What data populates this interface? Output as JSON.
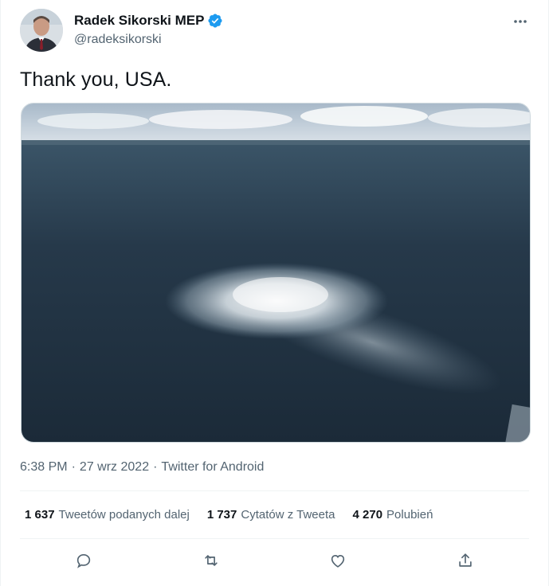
{
  "author": {
    "display_name": "Radek Sikorski MEP",
    "handle": "@radeksikorski",
    "verified_icon": "verified-badge-icon"
  },
  "tweet": {
    "text": "Thank you, USA.",
    "media_description_icon": "photo"
  },
  "meta": {
    "time": "6:38 PM",
    "separator1": "·",
    "date": "27 wrz 2022",
    "separator2": "·",
    "source": "Twitter for Android"
  },
  "stats": {
    "retweets": {
      "count": "1 637",
      "label": "Tweetów podanych dalej"
    },
    "quotes": {
      "count": "1 737",
      "label": "Cytatów z Tweeta"
    },
    "likes": {
      "count": "4 270",
      "label": "Polubień"
    }
  },
  "actions": [
    "reply-icon",
    "retweet-icon",
    "like-icon",
    "share-icon"
  ],
  "colors": {
    "primary_text": "#0f1419",
    "secondary_text": "#536471",
    "verified_blue": "#1d9bf0",
    "divider": "#eff3f4"
  }
}
